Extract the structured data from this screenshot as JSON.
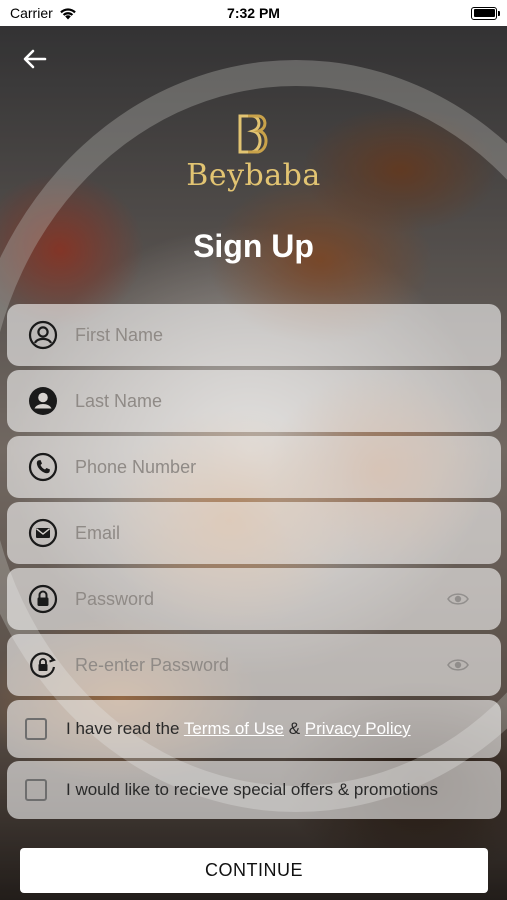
{
  "status_bar": {
    "carrier": "Carrier",
    "time": "7:32 PM"
  },
  "brand": {
    "name": "Beybaba",
    "color": "#e2c472"
  },
  "page": {
    "title": "Sign Up"
  },
  "form": {
    "first_name": {
      "placeholder": "First Name",
      "value": "",
      "icon": "user-circle-icon"
    },
    "last_name": {
      "placeholder": "Last Name",
      "value": "",
      "icon": "user-filled-circle-icon"
    },
    "phone": {
      "placeholder": "Phone Number",
      "value": "",
      "icon": "phone-icon"
    },
    "email": {
      "placeholder": "Email",
      "value": "",
      "icon": "envelope-icon"
    },
    "password": {
      "placeholder": "Password",
      "value": "",
      "icon": "lock-icon"
    },
    "reenter_password": {
      "placeholder": "Re-enter Password",
      "value": "",
      "icon": "lock-refresh-icon"
    }
  },
  "agreements": {
    "terms_prefix": "I have read the",
    "terms_link": "Terms of Use",
    "amp": "&",
    "privacy_link": "Privacy Policy",
    "offers_label": "I would like to recieve special offers & promotions"
  },
  "actions": {
    "continue_label": "CONTINUE"
  }
}
